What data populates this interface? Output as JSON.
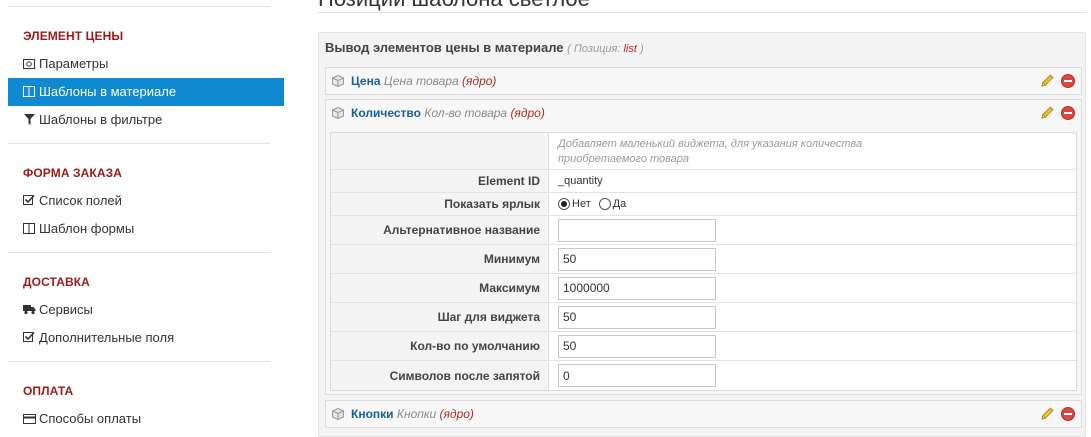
{
  "page": {
    "title": "Позиции шаблона светлое"
  },
  "sidebar": {
    "sections": [
      {
        "heading": "Элемент цены",
        "items": [
          {
            "label": "Параметры",
            "icon": "money-icon",
            "active": false
          },
          {
            "label": "Шаблоны в материале",
            "icon": "columns-icon",
            "active": true
          },
          {
            "label": "Шаблоны в фильтре",
            "icon": "filter-icon",
            "active": false
          }
        ]
      },
      {
        "heading": "Форма заказа",
        "items": [
          {
            "label": "Список полей",
            "icon": "checkbox-icon",
            "active": false
          },
          {
            "label": "Шаблон формы",
            "icon": "columns-icon",
            "active": false
          }
        ]
      },
      {
        "heading": "Доставка",
        "items": [
          {
            "label": "Сервисы",
            "icon": "truck-icon",
            "active": false
          },
          {
            "label": "Дополнительные поля",
            "icon": "checkbox-icon",
            "active": false
          }
        ]
      },
      {
        "heading": "Оплата",
        "items": [
          {
            "label": "Способы оплаты",
            "icon": "credit-card-icon",
            "active": false
          }
        ]
      }
    ]
  },
  "section": {
    "title": "Вывод элементов цены в материале",
    "position_prefix": "( Позиция:",
    "position_value": "list",
    "position_suffix": ")"
  },
  "elements": [
    {
      "name": "Цена",
      "desc": "Цена товара",
      "core": "(ядро)"
    },
    {
      "name": "Количество",
      "desc": "Кол-во товара",
      "core": "(ядро)"
    },
    {
      "name": "Кнопки",
      "desc": "Кнопки",
      "core": "(ядро)"
    }
  ],
  "quantity_params": {
    "description": "Добавляет маленький виджета, для указания количества приобретаемого товара",
    "element_id_label": "Element ID",
    "element_id_value": "_quantity",
    "show_label_label": "Показать ярлык",
    "radio_no": "Нет",
    "radio_yes": "Да",
    "radio_selected": "Нет",
    "alt_name_label": "Альтернативное название",
    "alt_name_value": "",
    "minimum_label": "Минимум",
    "minimum_value": "50",
    "maximum_label": "Максимум",
    "maximum_value": "1000000",
    "step_label": "Шаг для виджета",
    "step_value": "50",
    "default_label": "Кол-во по умолчанию",
    "default_value": "50",
    "decimals_label": "Символов после запятой",
    "decimals_value": "0"
  },
  "colors": {
    "accent": "#0f8ad0",
    "heading_red": "#9b1b1b",
    "element_blue": "#1a5e96",
    "delete_red": "#d9473f"
  }
}
